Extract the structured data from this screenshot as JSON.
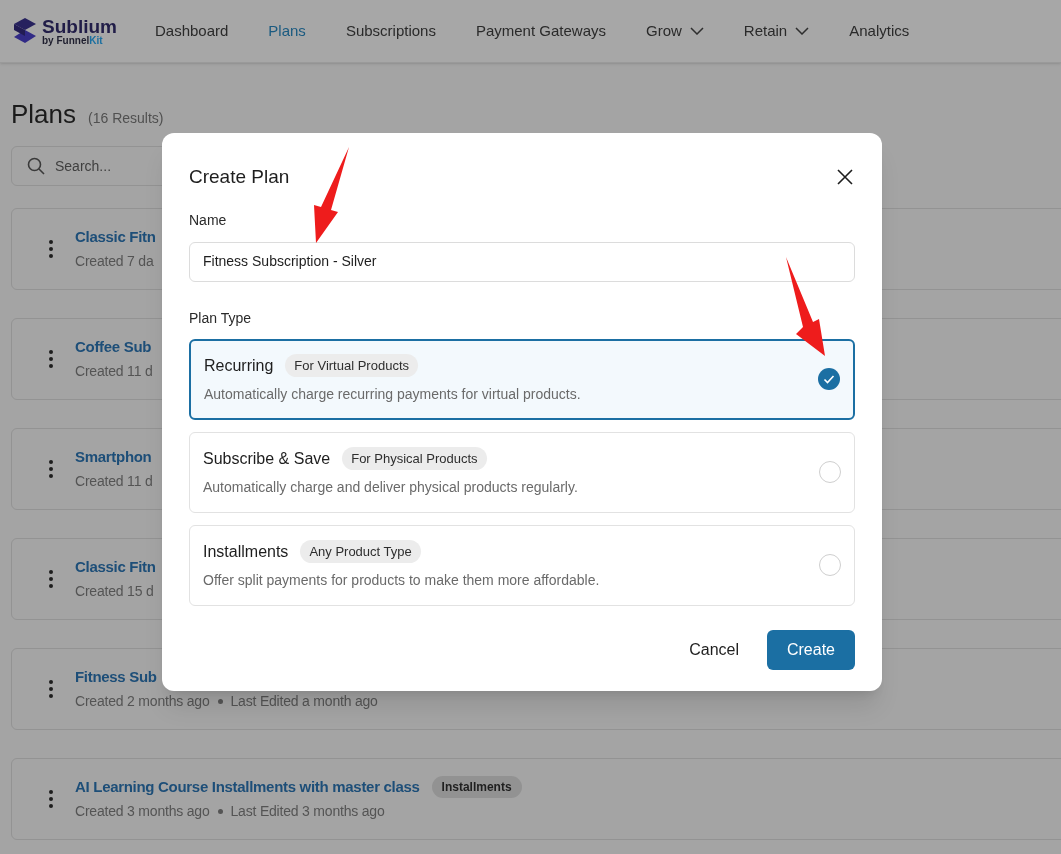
{
  "brand": {
    "name": "Sublium",
    "byline": "by ",
    "byline_bold": "Funnel",
    "byline_accent": "Kit"
  },
  "nav": [
    {
      "label": "Dashboard",
      "selected": false,
      "has_menu": false
    },
    {
      "label": "Plans",
      "selected": true,
      "has_menu": false
    },
    {
      "label": "Subscriptions",
      "selected": false,
      "has_menu": false
    },
    {
      "label": "Payment Gateways",
      "selected": false,
      "has_menu": false
    },
    {
      "label": "Grow",
      "selected": false,
      "has_menu": true
    },
    {
      "label": "Retain",
      "selected": false,
      "has_menu": true
    },
    {
      "label": "Analytics",
      "selected": false,
      "has_menu": false
    }
  ],
  "page": {
    "title": "Plans",
    "count": "(16 Results)",
    "search": {
      "placeholder": "Search..."
    }
  },
  "plans": [
    {
      "title": "Classic Fitn",
      "meta": [
        "Created 7 da"
      ]
    },
    {
      "title": "Coffee Sub",
      "meta": [
        "Created 11 d"
      ]
    },
    {
      "title": "Smartphon",
      "meta": [
        "Created 11 d"
      ]
    },
    {
      "title": "Classic Fitn",
      "meta": [
        "Created 15 d"
      ]
    },
    {
      "title": "Fitness Sub",
      "meta": [
        "Created 2 months ago",
        "Last Edited a month ago"
      ]
    },
    {
      "title": "AI Learning Course Installments with master class",
      "badge": "Installments",
      "meta": [
        "Created 3 months ago",
        "Last Edited 3 months ago"
      ]
    }
  ],
  "modal": {
    "title": "Create Plan",
    "name_label": "Name",
    "name_value": "Fitness Subscription - Silver",
    "type_label": "Plan Type",
    "options": [
      {
        "title": "Recurring",
        "badge": "For Virtual Products",
        "description": "Automatically charge recurring payments for virtual products.",
        "selected": true
      },
      {
        "title": "Subscribe & Save",
        "badge": "For Physical Products",
        "description": "Automatically charge and deliver physical products regularly.",
        "selected": false
      },
      {
        "title": "Installments",
        "badge": "Any Product Type",
        "description": "Offer split payments for products to make them more affordable.",
        "selected": false
      }
    ],
    "cancel": "Cancel",
    "submit": "Create"
  }
}
